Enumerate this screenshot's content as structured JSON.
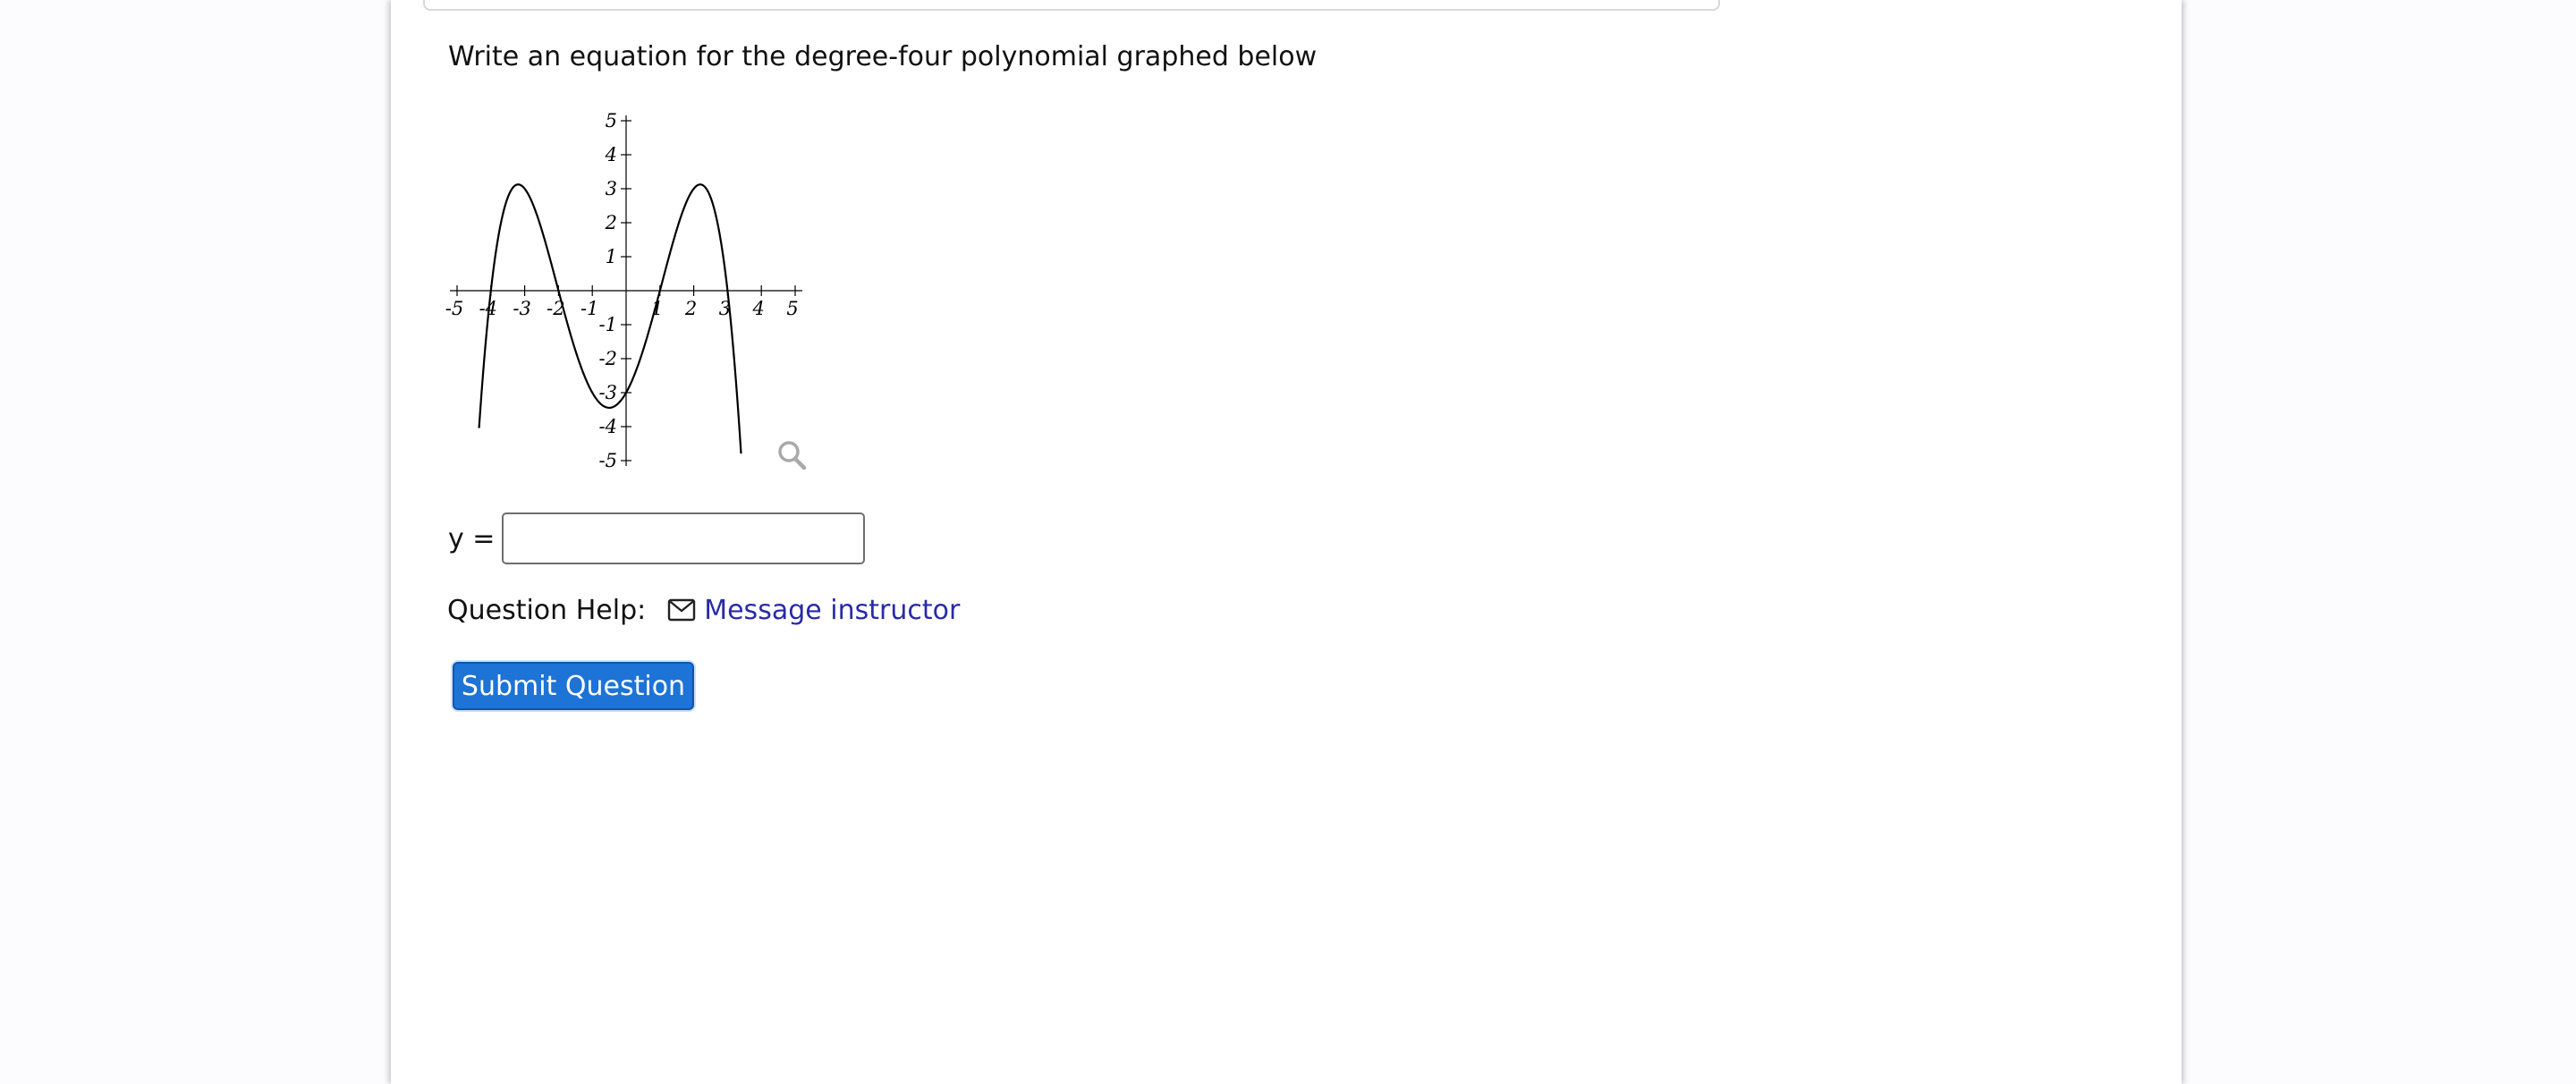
{
  "question": {
    "prompt": "Write an equation for the degree-four polynomial graphed below"
  },
  "answer": {
    "label": "y =",
    "value": "",
    "placeholder": ""
  },
  "help": {
    "label": "Question Help:",
    "link_label": "Message instructor"
  },
  "submit": {
    "label": "Submit Question"
  },
  "colors": {
    "link": "#2a2aa8",
    "button": "#1d73d6",
    "curve": "#000000"
  },
  "icons": {
    "magnifier": "magnifier-icon",
    "mail": "mail-icon"
  },
  "chart_data": {
    "type": "line",
    "xlim": [
      -5,
      5
    ],
    "ylim": [
      -5,
      5
    ],
    "x_ticks": [
      -5,
      -4,
      -3,
      -2,
      -1,
      1,
      2,
      3,
      4,
      5
    ],
    "y_ticks": [
      -5,
      -4,
      -3,
      -2,
      -1,
      1,
      2,
      3,
      4,
      5
    ],
    "grid": false,
    "series": [
      {
        "roots": [
          -4,
          -2,
          1,
          3
        ],
        "leading_coefficient": -0.125,
        "x_range": [
          -4.35,
          3.4
        ],
        "points": [
          {
            "x": -4,
            "y": 0
          },
          {
            "x": -3.1,
            "y": 3
          },
          {
            "x": -2,
            "y": 0
          },
          {
            "x": -0.5,
            "y": -3.2
          },
          {
            "x": 0,
            "y": -3
          },
          {
            "x": 1,
            "y": 0
          },
          {
            "x": 2.1,
            "y": 3
          },
          {
            "x": 3,
            "y": 0
          }
        ]
      }
    ]
  }
}
